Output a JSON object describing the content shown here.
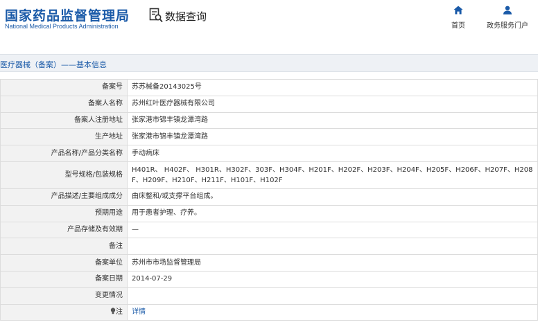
{
  "header": {
    "logo_cn": "国家药品监督管理局",
    "logo_en": "National Medical Products Administration",
    "query_label": "数据查询",
    "query_icon": "data-query-icon",
    "nav": [
      {
        "label": "首页",
        "icon": "home-icon"
      },
      {
        "label": "政务服务门户",
        "icon": "user-icon"
      }
    ]
  },
  "section": {
    "title": "医疗器械（备案）——基本信息"
  },
  "record": {
    "rows": [
      {
        "label": "备案号",
        "value": "苏苏械备20143025号"
      },
      {
        "label": "备案人名称",
        "value": "苏州红叶医疗器械有限公司"
      },
      {
        "label": "备案人注册地址",
        "value": "张家港市锦丰镇龙潭湾路"
      },
      {
        "label": "生产地址",
        "value": "张家港市锦丰镇龙潭湾路"
      },
      {
        "label": "产品名称/产品分类名称",
        "value": "手动病床"
      },
      {
        "label": "型号规格/包装规格",
        "value": "H401R、 H402F、 H301R、H302F、303F、H304F、H201F、H202F、H203F、H204F、H205F、H206F、H207F、H208F、H209F、H210F、H211F、H101F、H102F"
      },
      {
        "label": "产品描述/主要组成成分",
        "value": "由床整和/或支撑平台组成。"
      },
      {
        "label": "预期用途",
        "value": "用于患者护理、疗养。"
      },
      {
        "label": "产品存储及有效期",
        "value": "—"
      },
      {
        "label": "备注",
        "value": ""
      },
      {
        "label": "备案单位",
        "value": "苏州市市场监督管理局"
      },
      {
        "label": "备案日期",
        "value": "2014-07-29"
      },
      {
        "label": "变更情况",
        "value": ""
      },
      {
        "label": "注",
        "value": "详情"
      }
    ]
  },
  "colors": {
    "brand": "#1a5aa8",
    "label_bg": "#f2f2f2",
    "border": "#dcdcdc"
  }
}
